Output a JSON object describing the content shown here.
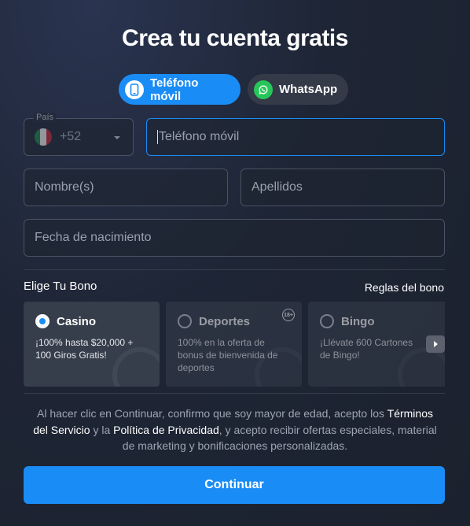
{
  "title": "Crea tu cuenta gratis",
  "method_tabs": [
    {
      "label": "Teléfono móvil",
      "icon": "phone-icon",
      "active": true
    },
    {
      "label": "WhatsApp",
      "icon": "whatsapp-icon",
      "active": false
    }
  ],
  "country": {
    "label": "País",
    "code": "+52",
    "flag": "mexico-flag-icon"
  },
  "phone": {
    "placeholder": "Teléfono móvil"
  },
  "names": {
    "placeholder": "Nombre(s)"
  },
  "surnames": {
    "placeholder": "Apellidos"
  },
  "birthdate": {
    "placeholder": "Fecha de nacimiento"
  },
  "bono": {
    "title": "Elige Tu Bono",
    "rules_link": "Reglas del bono",
    "cards": [
      {
        "name": "Casino",
        "desc": "¡100% hasta $20,000 + 100 Giros Gratis!",
        "selected": true
      },
      {
        "name": "Deportes",
        "desc": "100% en la oferta de bonus de bienvenida de deportes",
        "selected": false,
        "badge": "18+"
      },
      {
        "name": "Bingo",
        "desc": "¡Llévate 600 Cartones de Bingo!",
        "selected": false
      }
    ]
  },
  "legal": {
    "part1": "Al hacer clic en Continuar, confirmo que soy mayor de edad, acepto los ",
    "terms": "Términos del Servicio",
    "part2": " y la ",
    "privacy": "Política de Privacidad",
    "part3": ", y acepto recibir ofertas especiales, material de marketing y bonificaciones personalizadas."
  },
  "continue_label": "Continuar",
  "colors": {
    "accent": "#1a8cf5",
    "whatsapp": "#27c65a"
  }
}
